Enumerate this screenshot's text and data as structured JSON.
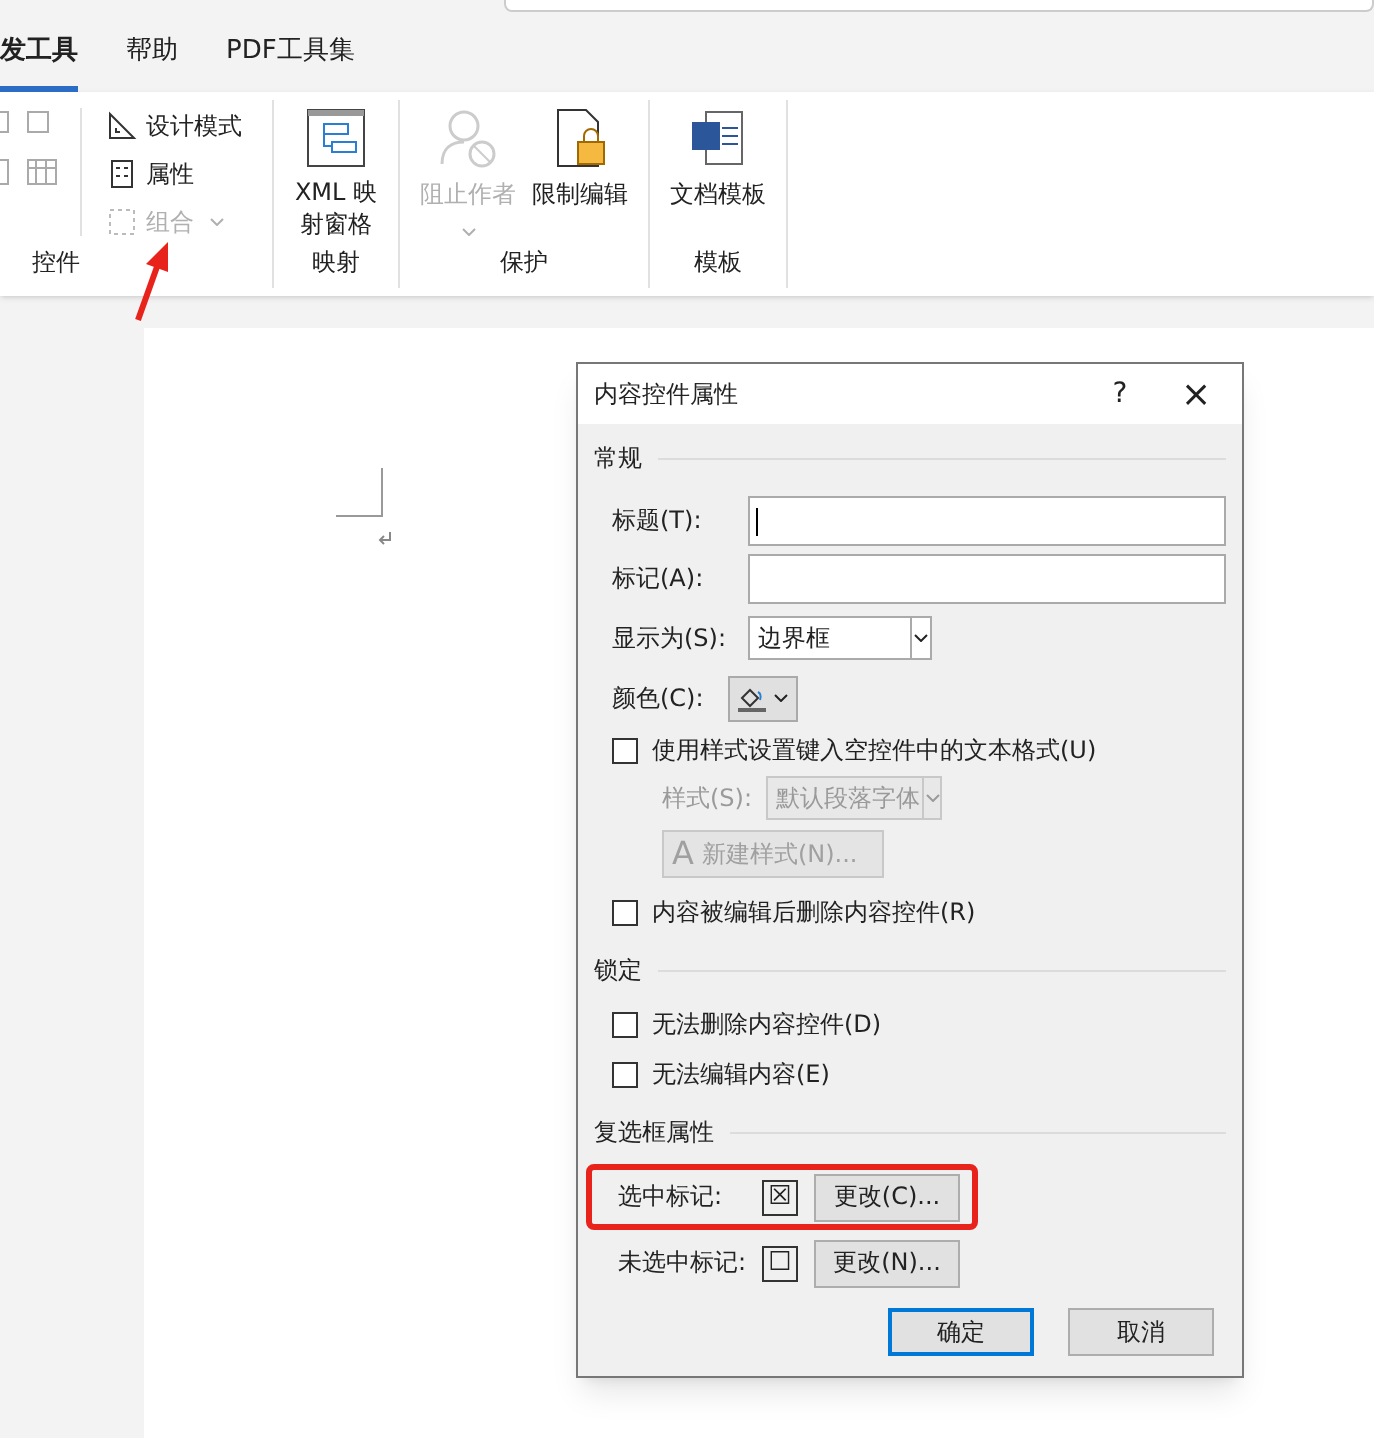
{
  "tabs": [
    {
      "label": "发工具",
      "selected": true
    },
    {
      "label": "帮助",
      "selected": false
    },
    {
      "label": "PDF工具集",
      "selected": false
    }
  ],
  "ribbon": {
    "controls": {
      "label": "控件",
      "items": [
        {
          "label": "设计模式",
          "disabled": false
        },
        {
          "label": "属性",
          "disabled": false
        },
        {
          "label": "组合",
          "disabled": true
        }
      ]
    },
    "mapping": {
      "label": "映射",
      "button": [
        "XML 映",
        "射窗格"
      ]
    },
    "protect": {
      "label": "保护",
      "items": [
        {
          "label": "阻止作者",
          "disabled": true
        },
        {
          "label": "限制编辑",
          "disabled": false
        }
      ]
    },
    "template": {
      "label": "模板",
      "button": "文档模板"
    }
  },
  "dialog": {
    "title": "内容控件属性",
    "help": "?",
    "close": "×",
    "general": {
      "heading": "常规",
      "title_label": "标题(T):",
      "tag_label": "标记(A):",
      "show_as_label": "显示为(S):",
      "show_as_value": "边界框",
      "color_label": "颜色(C):",
      "use_style": {
        "label": "使用样式设置键入空控件中的文本格式(U)",
        "checked": false
      },
      "style_label": "样式(S):",
      "style_value": "默认段落字体",
      "new_style": "新建样式(N)...",
      "new_style_icon": "A",
      "remove": {
        "label": "内容被编辑后删除内容控件(R)",
        "checked": false
      }
    },
    "locking": {
      "heading": "锁定",
      "items": [
        {
          "label": "无法删除内容控件(D)",
          "checked": false
        },
        {
          "label": "无法编辑内容(E)",
          "checked": false
        }
      ]
    },
    "checkbox_props": {
      "heading": "复选框属性",
      "rows": [
        {
          "label": "选中标记:",
          "symbol": "☒",
          "button": "更改(C)...",
          "highlighted": true
        },
        {
          "label": "未选中标记:",
          "symbol": "☐",
          "button": "更改(N)...",
          "highlighted": false
        }
      ]
    },
    "ok": "确定",
    "cancel": "取消"
  }
}
